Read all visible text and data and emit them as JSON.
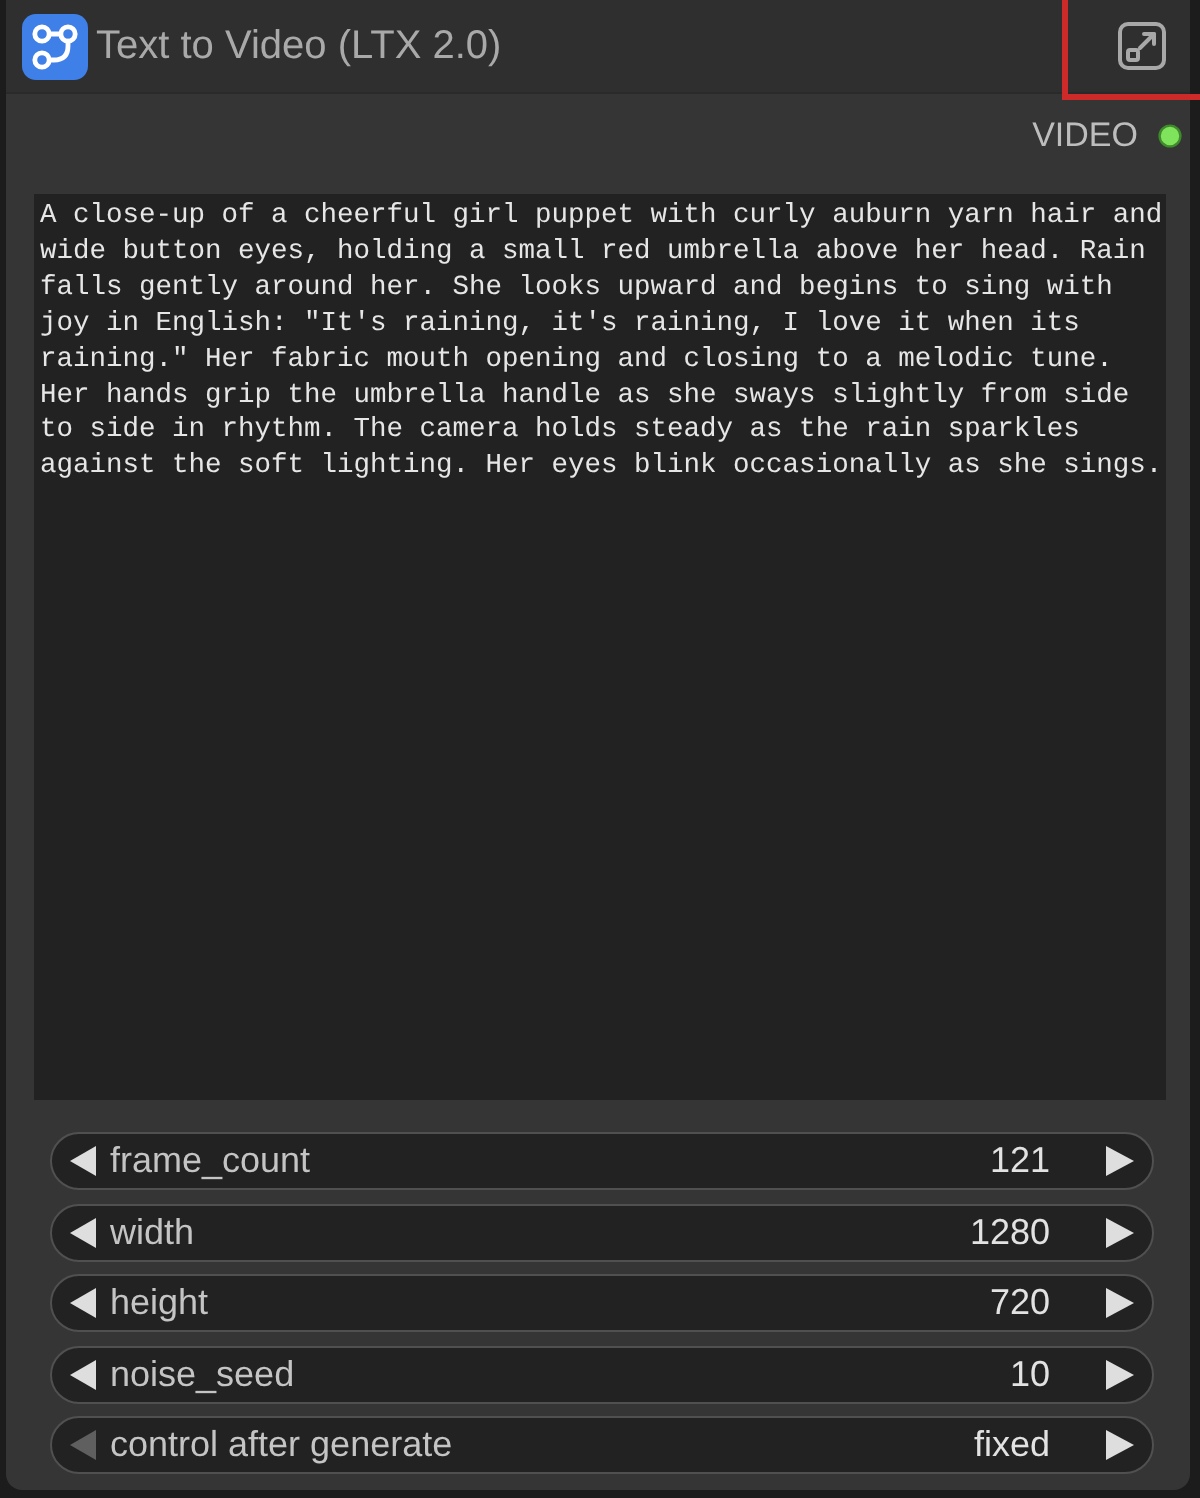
{
  "node": {
    "title": "Text to Video (LTX 2.0)"
  },
  "outputs": [
    {
      "label": "VIDEO"
    }
  ],
  "prompt": {
    "value": "A close-up of a cheerful girl puppet with curly auburn yarn hair and wide button eyes, holding a small red umbrella above her head. Rain falls gently around her. She looks upward and begins to sing with joy in English: \"It's raining, it's raining, I love it when its raining.\" Her fabric mouth opening and closing to a melodic tune. Her hands grip the umbrella handle as she sways slightly from side to side in rhythm. The camera holds steady as the rain sparkles against the soft lighting. Her eyes blink occasionally as she sings."
  },
  "widgets": [
    {
      "label": "frame_count",
      "value": "121",
      "decrement_disabled": false
    },
    {
      "label": "width",
      "value": "1280",
      "decrement_disabled": false
    },
    {
      "label": "height",
      "value": "720",
      "decrement_disabled": false
    },
    {
      "label": "noise_seed",
      "value": "10",
      "decrement_disabled": false
    },
    {
      "label": "control after generate",
      "value": "fixed",
      "decrement_disabled": true
    }
  ]
}
